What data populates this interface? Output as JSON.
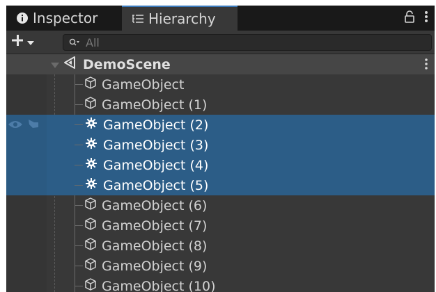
{
  "tabs": {
    "inspector": {
      "label": "Inspector",
      "icon": "info-icon"
    },
    "hierarchy": {
      "label": "Hierarchy",
      "icon": "list-icon"
    }
  },
  "toolbar": {
    "add_label": "+",
    "search_placeholder": "All"
  },
  "scene": {
    "name": "DemoScene",
    "icon": "unity-scene-icon"
  },
  "objects": [
    {
      "name": "GameObject",
      "selected": false,
      "icon": "cube-icon"
    },
    {
      "name": "GameObject (1)",
      "selected": false,
      "icon": "cube-icon"
    },
    {
      "name": "GameObject (2)",
      "selected": true,
      "icon": "gear-icon"
    },
    {
      "name": "GameObject (3)",
      "selected": true,
      "icon": "gear-icon"
    },
    {
      "name": "GameObject (4)",
      "selected": true,
      "icon": "gear-icon"
    },
    {
      "name": "GameObject (5)",
      "selected": true,
      "icon": "gear-icon"
    },
    {
      "name": "GameObject (6)",
      "selected": false,
      "icon": "cube-icon"
    },
    {
      "name": "GameObject (7)",
      "selected": false,
      "icon": "cube-icon"
    },
    {
      "name": "GameObject (8)",
      "selected": false,
      "icon": "cube-icon"
    },
    {
      "name": "GameObject (9)",
      "selected": false,
      "icon": "cube-icon"
    },
    {
      "name": "GameObject (10)",
      "selected": false,
      "icon": "cube-icon"
    }
  ],
  "colors": {
    "selection": "#2c5d87",
    "tab_accent": "#3a79bb",
    "panel": "#383838"
  }
}
